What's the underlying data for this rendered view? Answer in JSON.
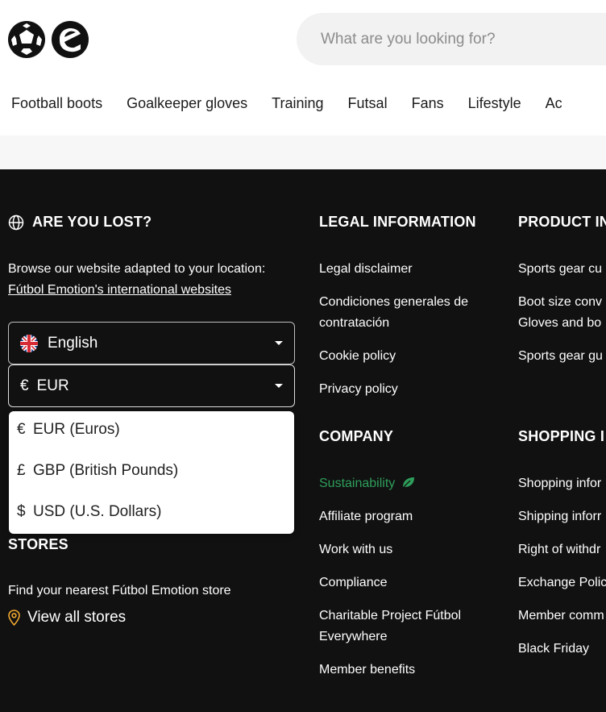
{
  "header": {
    "search_placeholder": "What are you looking for?",
    "nav": [
      "Football boots",
      "Goalkeeper gloves",
      "Training",
      "Futsal",
      "Fans",
      "Lifestyle",
      "Ac"
    ]
  },
  "footer": {
    "lost": {
      "title": "ARE YOU LOST?",
      "text": "Browse our website adapted to your location:",
      "link": "Fútbol Emotion's international websites",
      "language_value": "English",
      "currency_symbol": "€",
      "currency_value": "EUR",
      "currency_options": [
        {
          "symbol": "€",
          "label": "EUR (Euros)"
        },
        {
          "symbol": "£",
          "label": "GBP (British Pounds)"
        },
        {
          "symbol": "$",
          "label": "USD (U.S. Dollars)"
        }
      ]
    },
    "stores": {
      "title": "STORES",
      "text": "Find your nearest Fútbol Emotion store",
      "link": "View all stores"
    },
    "legal": {
      "title": "LEGAL INFORMATION",
      "links": [
        "Legal disclaimer",
        "Condiciones generales de",
        "contratación",
        "Cookie policy",
        "Privacy policy"
      ]
    },
    "company": {
      "title": "COMPANY",
      "links": [
        "Sustainability",
        "Affiliate program",
        "Work with us",
        "Compliance",
        "Charitable Project Fútbol",
        "Everywhere",
        "Member benefits"
      ]
    },
    "product": {
      "title": "PRODUCT IN",
      "links": [
        "Sports gear cu",
        "Boot size conv",
        "Gloves and bo",
        "Sports gear gu"
      ]
    },
    "shopping": {
      "title": "SHOPPING I",
      "links": [
        "Shopping infor",
        "Shipping inforr",
        "Right of withdr",
        "Exchange Polic",
        "Member comm",
        "Black Friday"
      ]
    }
  },
  "colors": {
    "footer_bg": "#111111",
    "accent_green": "#2e9e5b",
    "store_pin": "#f0a830"
  }
}
